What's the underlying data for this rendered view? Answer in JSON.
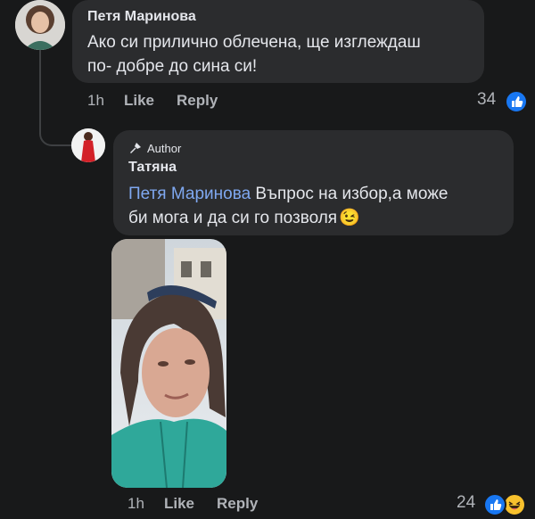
{
  "comment1": {
    "author": "Петя Маринова",
    "text_line1": "Ако си прилично облечена, ще изглеждаш",
    "text_line2": "по- добре до сина си!",
    "time": "1h",
    "like_label": "Like",
    "reply_label": "Reply",
    "reaction_count": "34",
    "reaction_icons": [
      "like-reaction-icon"
    ]
  },
  "reply1": {
    "badge": "Author",
    "author": "Татяна",
    "mention": "Петя Маринова",
    "text_line1_rest": " Въпрос на избор,а може",
    "text_line2": "би мога и да си го позволя",
    "emoji": "😉",
    "time": "1h",
    "like_label": "Like",
    "reply_label": "Reply",
    "reaction_count": "24",
    "reaction_icons": [
      "like-reaction-icon",
      "haha-reaction-icon"
    ]
  },
  "colors": {
    "background": "#18191a",
    "bubble": "#2b2c2e",
    "mention": "#7fa8f0",
    "like_blue": "#1877f2"
  }
}
